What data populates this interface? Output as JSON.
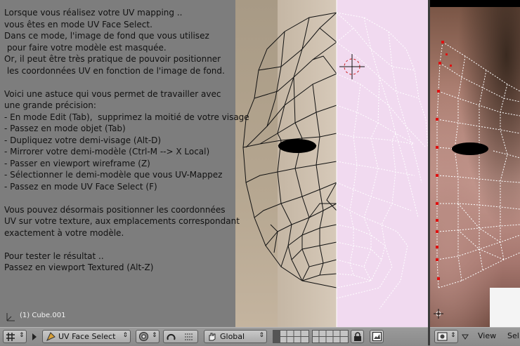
{
  "viewport": {
    "instructions": [
      "Lorsque vous réalisez votre UV mapping ..",
      "vous êtes en mode UV Face Select.",
      "Dans ce mode, l'image de fond que vous utilisez",
      " pour faire votre modèle est masquée.",
      "Or, il peut être très pratique de pouvoir positionner",
      " les coordonnées UV en fonction de l'image de fond.",
      "",
      "Voici une astuce qui vous permet de travailler avec",
      "une grande précision:",
      "- En mode Edit (Tab),  supprimez la moitié de votre visage",
      "- Passez en mode objet (Tab)",
      "- Dupliquez votre demi-visage (Alt-D)",
      "- Mirrorer votre demi-modèle (Ctrl-M --> X Local)",
      "- Passer en viewport wireframe (Z)",
      "- Sélectionner le demi-modèle que vous UV-Mappez",
      "- Passez en mode UV Face Select (F)",
      "",
      "Vous pouvez désormais positionner les coordonnées",
      "UV sur votre texture, aux emplacements correspondant",
      "exactement à votre modèle.",
      "",
      "Pour tester le résultat ..",
      "Passez en viewport Textured (Alt-Z)"
    ],
    "object_label": "(1) Cube.001"
  },
  "header3d": {
    "mode_label": "UV Face Select",
    "orientation_label": "Global",
    "icons": [
      "window-type-icon",
      "menu-collapse-icon",
      "mode-icon",
      "draw-type-icon",
      "pivot-icon",
      "snap-icon",
      "manipulator-hand-icon",
      "lock-icon",
      "render-icon"
    ]
  },
  "headeruv": {
    "menu_view": "View",
    "menu_select": "Sel",
    "icons": [
      "image-editor-icon",
      "menu-collapse-icon"
    ]
  },
  "colors": {
    "viewport_bg": "#7d7d7d",
    "mirror_half": "#f1daf0",
    "header_bg": "#9a9a9a",
    "uv_vertex": "#e01010"
  }
}
